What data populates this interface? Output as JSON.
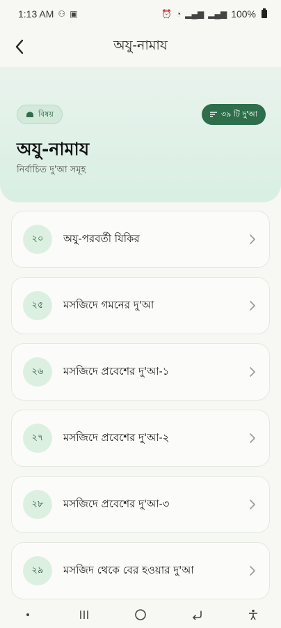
{
  "status_bar": {
    "time": "1:13 AM",
    "battery": "100%"
  },
  "app_bar": {
    "title": "অযু-নামায"
  },
  "header": {
    "topic_chip": "বিষয়",
    "count_pill": "৩৯ টি দু'আ",
    "title": "অযু-নামায",
    "subtitle": "নির্বাচিত দু'আ সমূহ"
  },
  "duas": [
    {
      "number": "২০",
      "label": "অযু-পরবর্তী যিকির"
    },
    {
      "number": "২৫",
      "label": "মসজিদে গমনের দু'আ"
    },
    {
      "number": "২৬",
      "label": "মসজিদে প্রবেশের দু'আ-১"
    },
    {
      "number": "২৭",
      "label": "মসজিদে প্রবেশের দু'আ-২"
    },
    {
      "number": "২৮",
      "label": "মসজিদে প্রবেশের দু'আ-৩"
    },
    {
      "number": "২৯",
      "label": "মসজিদ থেকে বের হওয়ার দু'আ"
    }
  ],
  "colors": {
    "accent": "#2e6e4b",
    "header_bg": "#d9efe3",
    "badge_bg": "#dcf0e2"
  }
}
